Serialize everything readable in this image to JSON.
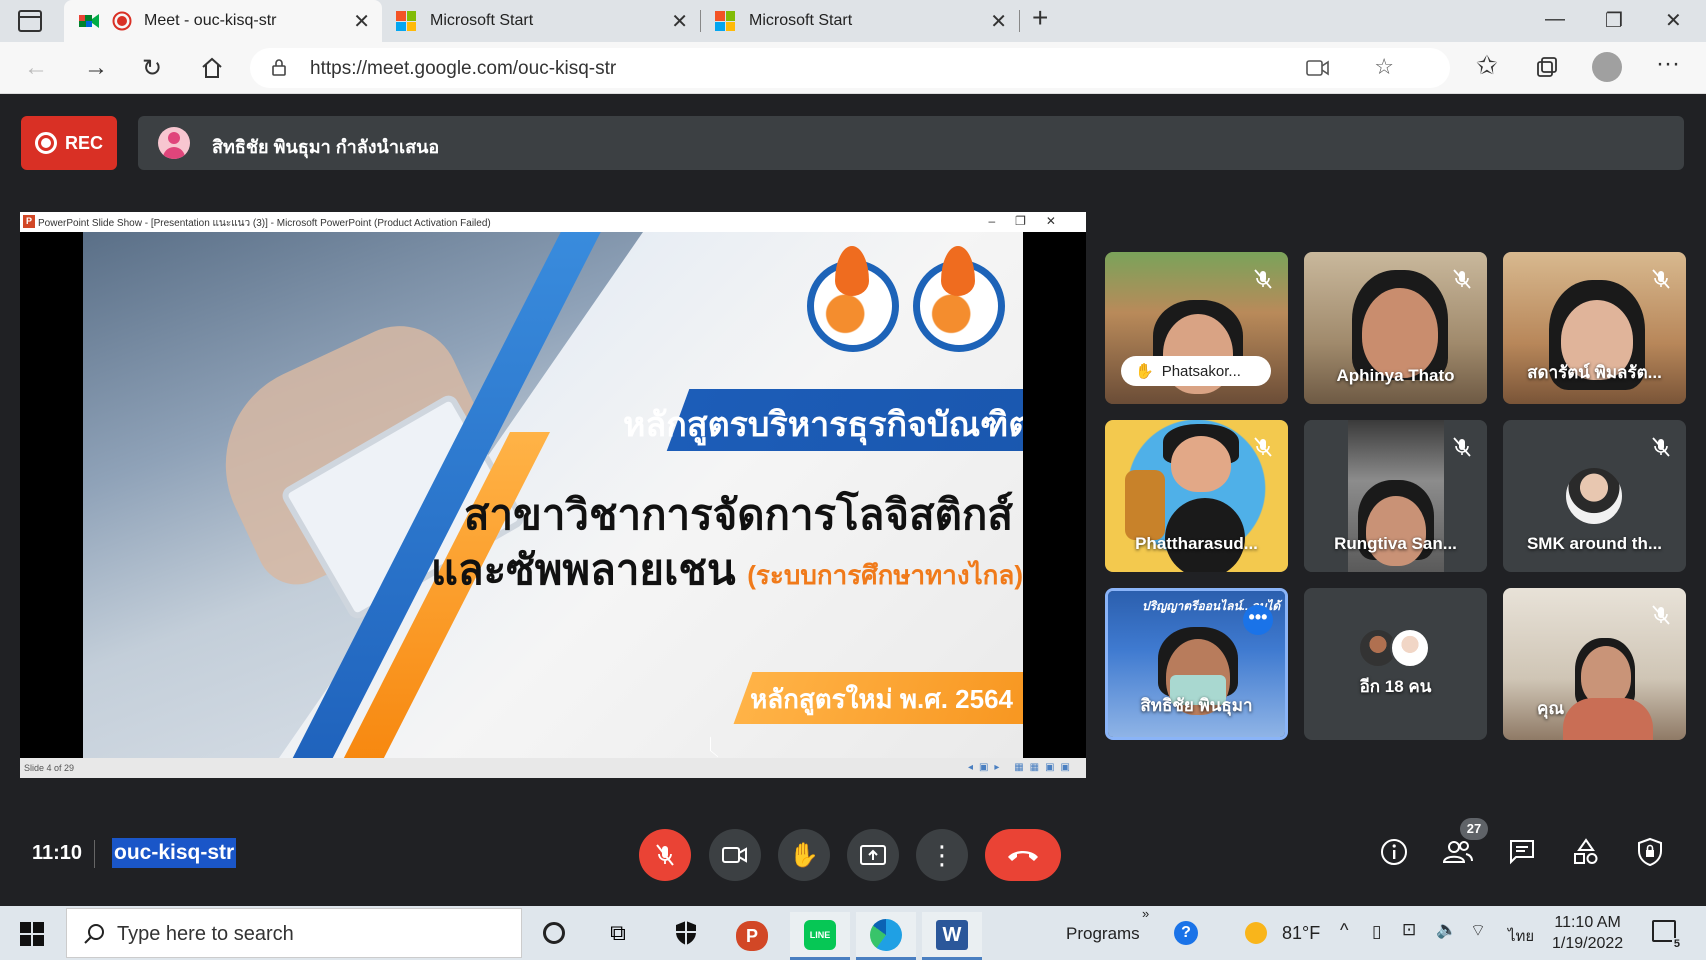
{
  "browser": {
    "tabs": [
      {
        "label": "Meet - ouc-kisq-str",
        "active": true
      },
      {
        "label": "Microsoft Start",
        "active": false
      },
      {
        "label": "Microsoft Start",
        "active": false
      }
    ],
    "url": "https://meet.google.com/ouc-kisq-str"
  },
  "meet": {
    "rec_label": "REC",
    "presenter_text": "สิทธิชัย พินธุมา กำลังนำเสนอ",
    "presentation": {
      "window_title": "PowerPoint Slide Show - [Presentation แนะแนว (3)] - Microsoft PowerPoint (Product Activation Failed)",
      "banner_text": "หลักสูตรบริหารธุรกิจบัณฑิต",
      "line1": "สาขาวิชาการจัดการโลจิสติกส์",
      "line2": "และซัพพลายเชน",
      "line2_note": "(ระบบการศึกษาทางไกล)",
      "orange_text": "หลักสูตรใหม่ พ.ศ. 2564",
      "status": "Slide 4 of 29"
    },
    "participants": [
      {
        "name": "Phatsakor...",
        "muted": true,
        "hand_raised": true
      },
      {
        "name": "Aphinya Thato",
        "muted": true
      },
      {
        "name": "สดารัตน์ พิมลรัต...",
        "muted": true
      },
      {
        "name": "Phattharasud...",
        "muted": true
      },
      {
        "name": "Rungtiva San...",
        "muted": true
      },
      {
        "name": "SMK around th...",
        "muted": true
      },
      {
        "name": "สิทธิชัย พินธุมา",
        "overlay_text": "ปริญญาตรีออนไลน์...จบได้",
        "presenting": true
      },
      {
        "name": "อีก 18 คน"
      },
      {
        "name": "คุณ",
        "muted": true
      }
    ],
    "time": "11:10",
    "meeting_code": "ouc-kisq-str",
    "participant_count": "27"
  },
  "taskbar": {
    "search_placeholder": "Type here to search",
    "programs_label": "Programs",
    "temperature": "81°F",
    "language": "ไทย",
    "clock_time": "11:10 AM",
    "clock_date": "1/19/2022",
    "notification_count": "5"
  },
  "colors": {
    "meet_bg": "#202124",
    "rec_red": "#d93025",
    "end_call_red": "#ea4335",
    "highlight_blue": "#1a56c8"
  }
}
